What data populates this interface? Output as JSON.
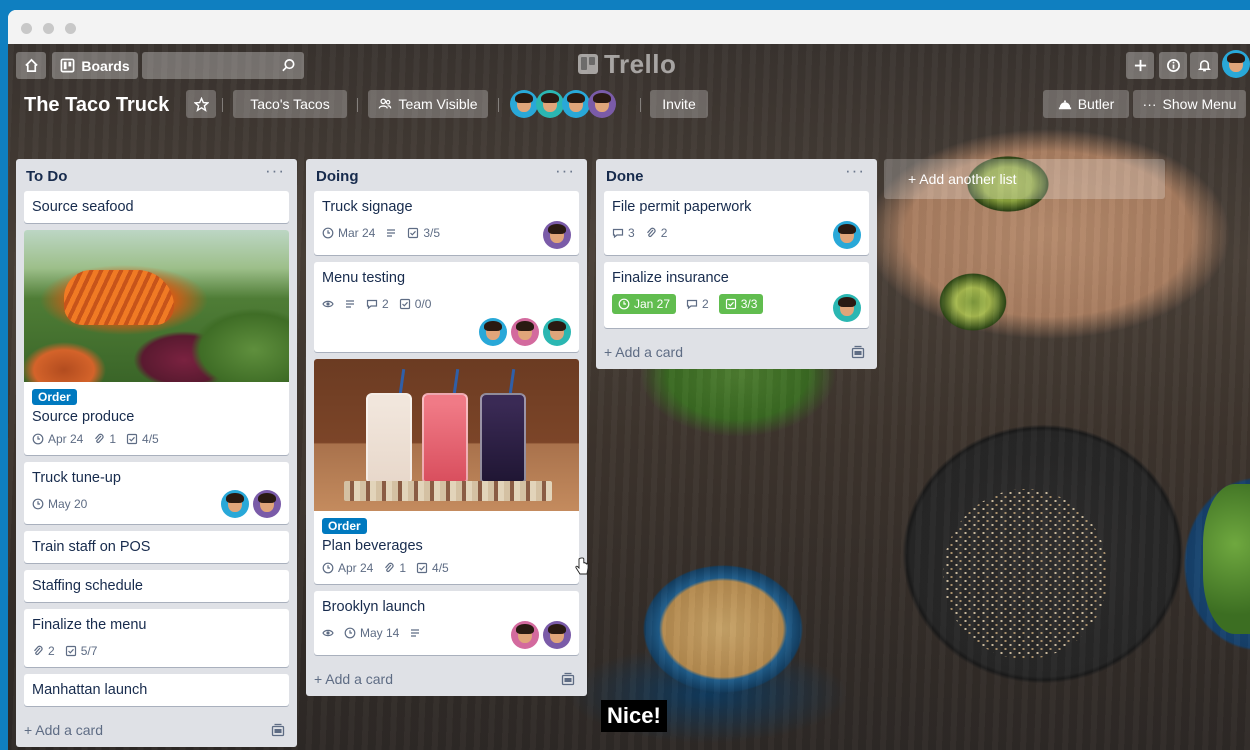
{
  "app": {
    "logo_text": "Trello"
  },
  "topnav": {
    "boards_label": "Boards",
    "search_placeholder": ""
  },
  "board": {
    "title": "The Taco Truck",
    "team": "Taco's Tacos",
    "visibility": "Team Visible",
    "invite_label": "Invite",
    "butler_label": "Butler",
    "menu_label": "Show Menu"
  },
  "lists": [
    {
      "title": "To Do",
      "add_card": "+ Add a card",
      "cards": [
        {
          "title": "Source seafood"
        },
        {
          "title": "Source produce",
          "label": "Order",
          "due": "Apr 24",
          "attachments": "1",
          "checklist": "4/5"
        },
        {
          "title": "Truck tune-up",
          "due": "May 20"
        },
        {
          "title": "Train staff on POS"
        },
        {
          "title": "Staffing schedule"
        },
        {
          "title": "Finalize the menu",
          "attachments": "2",
          "checklist": "5/7"
        },
        {
          "title": "Manhattan launch"
        }
      ]
    },
    {
      "title": "Doing",
      "add_card": "+ Add a card",
      "cards": [
        {
          "title": "Truck signage",
          "due": "Mar 24",
          "checklist": "3/5"
        },
        {
          "title": "Menu testing",
          "comments": "2",
          "checklist": "0/0"
        },
        {
          "title": "Plan beverages",
          "label": "Order",
          "due": "Apr 24",
          "attachments": "1",
          "checklist": "4/5"
        },
        {
          "title": "Brooklyn launch",
          "due": "May 14"
        }
      ]
    },
    {
      "title": "Done",
      "add_card": "+ Add a card",
      "cards": [
        {
          "title": "File permit paperwork",
          "comments": "3",
          "attachments": "2"
        },
        {
          "title": "Finalize insurance",
          "due": "Jan 27",
          "comments": "2",
          "checklist": "3/3"
        }
      ]
    }
  ],
  "add_list_label": "+ Add another list",
  "caption": "Nice!",
  "colors": {
    "list_bg": "#dfe1e6",
    "label_blue": "#0079bf",
    "done_green": "#61bd4f",
    "window_frame": "#0f7fc0"
  }
}
